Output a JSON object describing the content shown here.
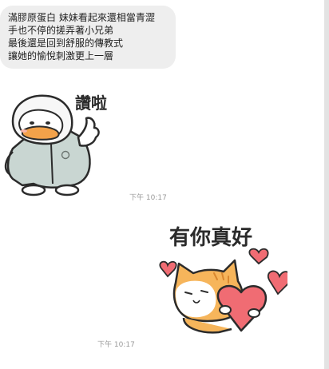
{
  "message": {
    "lines": [
      "滿膠原蛋白 妹妹看起來還相當青澀",
      "手也不停的搓弄著小兄弟",
      "最後還是回到舒服的傳教式",
      "讓她的愉悅刺激更上一層"
    ]
  },
  "stickers": {
    "left_caption": "讚啦",
    "right_caption": "有你真好"
  },
  "timestamps": {
    "first": "下午 10:17",
    "second": "下午 10:17"
  },
  "colors": {
    "bubble": "#eeeeee",
    "timestamp": "#9a9a9a",
    "duck_hoodie": "#c9d6d2",
    "duck_beak": "#f3a24a",
    "cat_fur": "#f6b55b",
    "heart": "#f06c73"
  }
}
